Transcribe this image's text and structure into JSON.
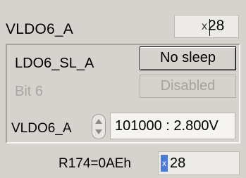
{
  "header": {
    "title": "VLDO6_A",
    "hex_prefix": "x",
    "hex_value": "28"
  },
  "group": {
    "ldo_label": "LDO6_SL_A",
    "sleep_button": "No sleep",
    "bit_label": "Bit 6",
    "bit_button": "Disabled",
    "voltage_label": "VLDO6_A",
    "voltage_value": "101000 : 2.800V"
  },
  "register": {
    "label": "R174=0AEh",
    "hex_prefix": "x",
    "hex_value": "28"
  }
}
